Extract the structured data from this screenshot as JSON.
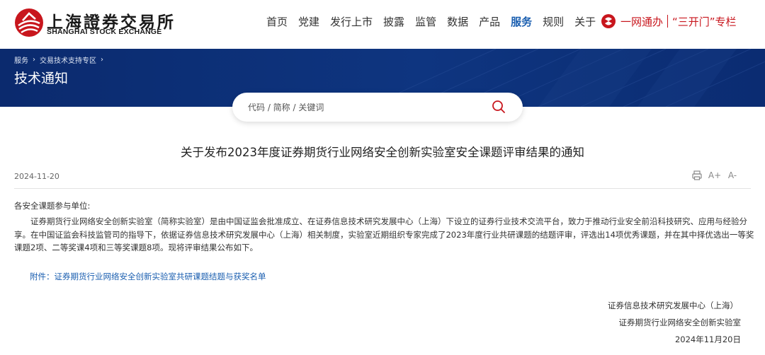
{
  "header": {
    "logo_cn": "上海證券交易所",
    "logo_en": "SHANGHAI STOCK EXCHANGE",
    "nav": [
      {
        "label": "首页",
        "active": false
      },
      {
        "label": "党建",
        "active": false
      },
      {
        "label": "发行上市",
        "active": false
      },
      {
        "label": "披露",
        "active": false
      },
      {
        "label": "监管",
        "active": false
      },
      {
        "label": "数据",
        "active": false
      },
      {
        "label": "产品",
        "active": false
      },
      {
        "label": "服务",
        "active": true
      },
      {
        "label": "规则",
        "active": false
      },
      {
        "label": "关于",
        "active": false
      }
    ],
    "gov_service": "一网通办",
    "gov_special": "“三开门”专栏",
    "accent_color": "#c8161d",
    "active_nav_color": "#1b5fb0"
  },
  "banner": {
    "breadcrumb": [
      "服务",
      "交易技术支持专区"
    ],
    "title": "技术通知",
    "background_color": "#0d3078"
  },
  "search": {
    "placeholder": "代码 / 简称 / 关键词",
    "icon": "search-icon"
  },
  "article": {
    "title": "关于发布2023年度证券期货行业网络安全创新实验室安全课题评审结果的通知",
    "date": "2024-11-20",
    "tools": {
      "print_icon": "print-icon",
      "font_larger": "A+",
      "font_smaller": "A-"
    },
    "salutation": "各安全课题参与单位:",
    "body": "证券期货行业网络安全创新实验室（简称实验室）是由中国证监会批准成立、在证券信息技术研究发展中心（上海）下设立的证券行业技术交流平台，致力于推动行业安全前沿科技研究、应用与经验分享。在中国证监会科技监管司的指导下，依据证券信息技术研究发展中心（上海）相关制度，实验室近期组织专家完成了2023年度行业共研课题的结题评审，评选出14项优秀课题，并在其中择优选出一等奖课题2项、二等奖课4项和三等奖课题8项。现将评审结果公布如下。",
    "attachment": "附件：证券期货行业网络安全创新实验室共研课题结题与获奖名单",
    "signature": [
      "证券信息技术研究发展中心（上海）",
      "证券期货行业网络安全创新实验室",
      "2024年11月20日"
    ]
  }
}
